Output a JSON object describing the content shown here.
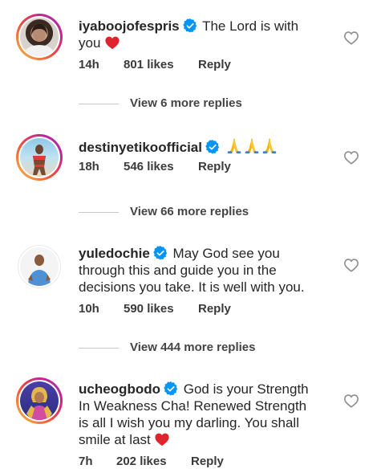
{
  "comments": [
    {
      "username": "iyaboojofespris",
      "text": "The Lord is with you",
      "time": "14h",
      "likes": "801 likes",
      "reply": "Reply",
      "view_replies": "View 6 more replies",
      "avatar_ring": "story"
    },
    {
      "username": "destinyetikoofficial",
      "text": "",
      "time": "18h",
      "likes": "546 likes",
      "reply": "Reply",
      "view_replies": "View 66 more replies",
      "avatar_ring": "story"
    },
    {
      "username": "yuledochie",
      "text": "May God see you through this and guide you in the decisions you take. It is well with you.",
      "time": "10h",
      "likes": "590 likes",
      "reply": "Reply",
      "view_replies": "View 444 more replies",
      "avatar_ring": "none"
    },
    {
      "username": "ucheogbodo",
      "text": "God is your Strength In Weakness Cha! Renewed Strength is all I wish you my darling. You shall smile at last",
      "time": "7h",
      "likes": "202 likes",
      "reply": "Reply",
      "avatar_ring": "story"
    }
  ],
  "icons": {
    "verified": "verified-badge-icon",
    "like": "heart-outline-icon",
    "emoji_heart": "red-heart-emoji",
    "emoji_pray": "praying-hands-emoji"
  },
  "colors": {
    "verified_blue": "#0095f6",
    "heart_red": "#e0242e",
    "text": "#262626",
    "muted": "#8e8e8e"
  }
}
